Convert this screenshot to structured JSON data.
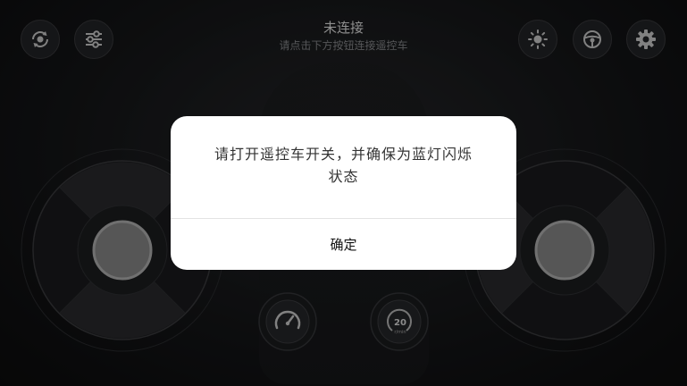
{
  "status": {
    "title": "未连接",
    "subtitle": "请点击下方按钮连接遥控车"
  },
  "toolbar": {
    "left": [
      "rotate-icon",
      "sliders-icon"
    ],
    "right": [
      "brightness-icon",
      "steering-wheel-icon",
      "settings-gear-icon"
    ]
  },
  "dials": {
    "speed_limit": "20",
    "speed_unit": "r/min"
  },
  "dialog": {
    "message_line1": "请打开遥控车开关，并确保为蓝灯闪烁",
    "message_line2": "状态",
    "confirm_label": "确定"
  },
  "colors": {
    "background": "#141517",
    "dialog_bg": "#ffffff",
    "button_bg": "#232427",
    "knob": "#8c8c8c"
  }
}
